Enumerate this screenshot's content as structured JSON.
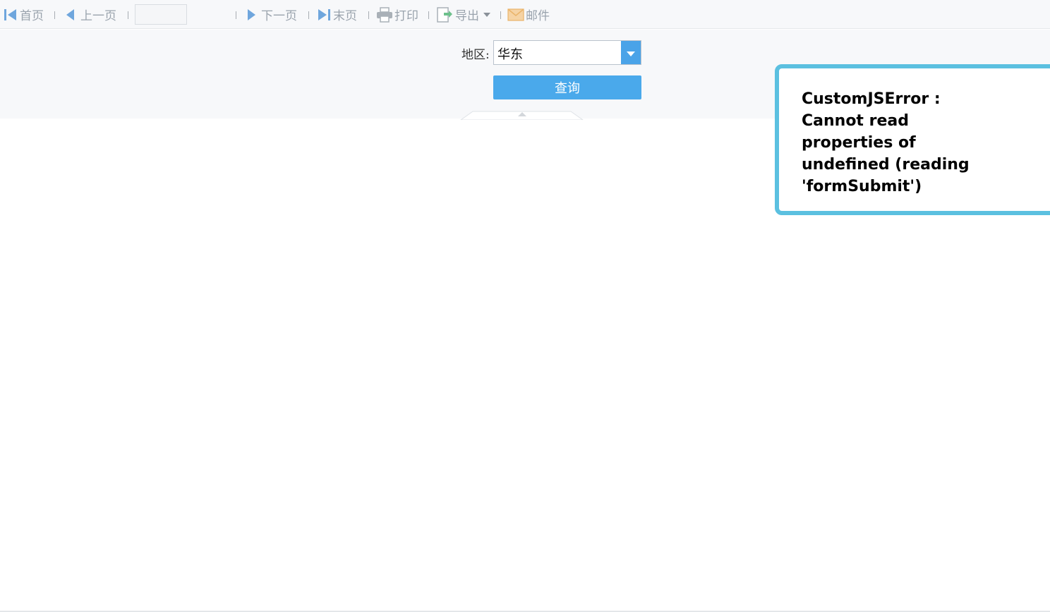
{
  "toolbar": {
    "first": "首页",
    "prev": "上一页",
    "page_value": "",
    "next": "下一页",
    "last": "末页",
    "print": "打印",
    "export": "导出",
    "mail": "邮件"
  },
  "params": {
    "region_label": "地区:",
    "region_value": "华东",
    "query_label": "查询"
  },
  "error": {
    "message": "CustomJSError : Cannot read properties of undefined (reading 'formSubmit')"
  },
  "colors": {
    "accent": "#4aa9eb",
    "error_border": "#5bc0e0"
  }
}
